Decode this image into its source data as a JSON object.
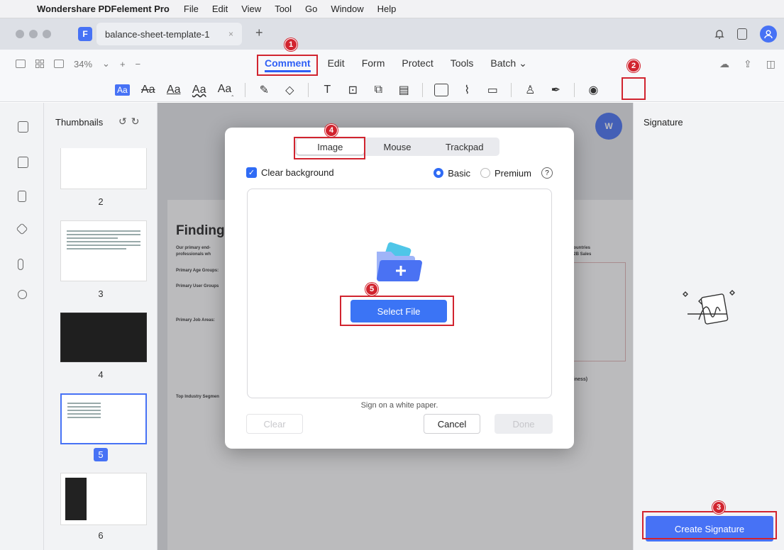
{
  "menubar": {
    "app_name": "Wondershare PDFelement Pro",
    "items": [
      "File",
      "Edit",
      "View",
      "Tool",
      "Go",
      "Window",
      "Help"
    ]
  },
  "tab": {
    "doc_title": "balance-sheet-template-1",
    "close": "×",
    "new": "+"
  },
  "toolbar": {
    "zoom": "34%",
    "tabs": [
      "Comment",
      "Edit",
      "Form",
      "Protect",
      "Tools",
      "Batch ⌄"
    ],
    "active_tab": "Comment"
  },
  "thumbnails": {
    "title": "Thumbnails",
    "pages": [
      "2",
      "3",
      "4",
      "5",
      "6"
    ],
    "selected": "5"
  },
  "document": {
    "heading": "Findings",
    "lines": [
      "Our primary end-",
      "professionals wh",
      "Primary Age Groups:",
      "Primary User Groups",
      "Primary Job Areas:",
      "Top Industry Segmen"
    ],
    "right_lines": [
      "Countries",
      "B2B Sales",
      "siness)"
    ],
    "word_badge": "W"
  },
  "signature_panel": {
    "title": "Signature",
    "create_button": "Create Signature"
  },
  "modal": {
    "segments": [
      "Image",
      "Mouse",
      "Trackpad"
    ],
    "active_segment": "Image",
    "clear_background": "Clear background",
    "basic": "Basic",
    "premium": "Premium",
    "help": "?",
    "select_file": "Select File",
    "hint": "Sign on a white paper.",
    "clear": "Clear",
    "cancel": "Cancel",
    "done": "Done"
  },
  "callouts": [
    "1",
    "2",
    "3",
    "4",
    "5"
  ],
  "colors": {
    "accent": "#4772f5",
    "callout": "#d1242f"
  }
}
